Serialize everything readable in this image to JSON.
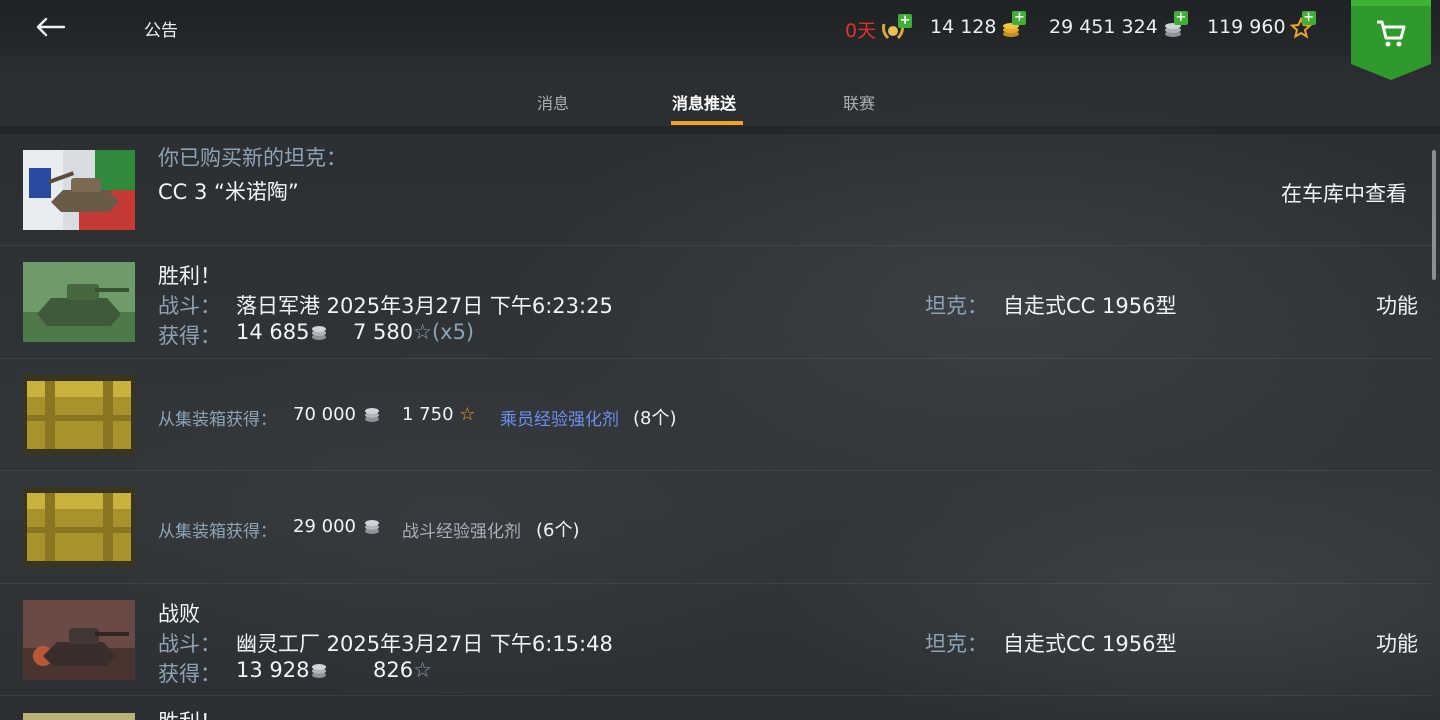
{
  "header": {
    "title": "公告",
    "currencies": {
      "premium_days": "0天",
      "gold": "14 128",
      "credits": "29 451 324",
      "free_xp": "119 960"
    }
  },
  "tabs": [
    {
      "label": "消息",
      "active": false
    },
    {
      "label": "消息推送",
      "active": true
    },
    {
      "label": "联赛",
      "active": false
    }
  ],
  "colors": {
    "accent": "#f0a325",
    "label": "#8ea2b6",
    "link": "#6f8ff0",
    "premium_red": "#e0312b",
    "shop_green": "#2f9a2b"
  },
  "messages": {
    "purchase": {
      "heading": "你已购买新的坦克：",
      "tank": "CC 3 “米诺陶”",
      "action": "在车库中查看"
    },
    "victory1": {
      "title": "胜利！",
      "battle_label": "战斗：",
      "battle_value": "落日军港 2025年3月27日 下午6:23:25",
      "earned_label": "获得：",
      "credits": "14 685",
      "xp": "7 580",
      "xp_mult": "(x5)",
      "tank_label": "坦克：",
      "tank_value": "自走式CC 1956型",
      "action": "功能"
    },
    "box1": {
      "label": "从集装箱获得：",
      "credits": "70 000",
      "xp": "1 750",
      "booster": "乘员经验强化剂",
      "count": "(8个)"
    },
    "box2": {
      "label": "从集装箱获得：",
      "credits": "29 000",
      "booster": "战斗经验强化剂",
      "count": "(6个)"
    },
    "defeat": {
      "title": "战败",
      "battle_label": "战斗：",
      "battle_value": "幽灵工厂 2025年3月27日 下午6:15:48",
      "earned_label": "获得：",
      "credits": "13 928",
      "xp": "826",
      "tank_label": "坦克：",
      "tank_value": "自走式CC 1956型",
      "action": "功能"
    },
    "victory2": {
      "title": "胜利！"
    }
  }
}
